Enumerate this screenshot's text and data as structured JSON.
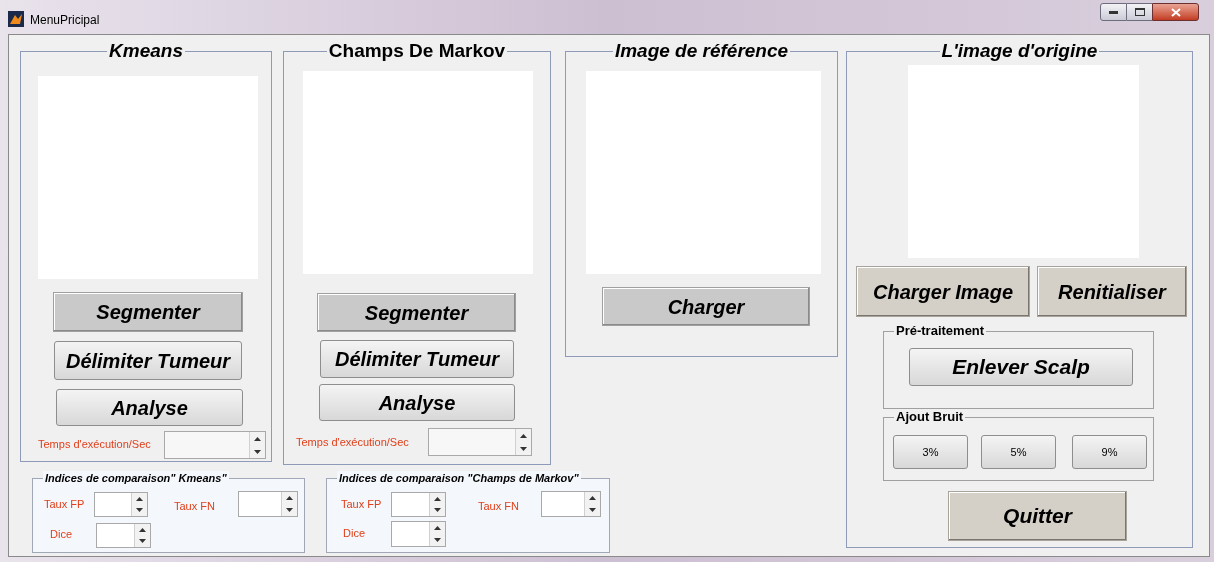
{
  "window": {
    "title": "MenuPricipal"
  },
  "panels": [
    {
      "title": "Kmeans",
      "buttons": [
        {
          "label": "Segmenter",
          "kind": "flat"
        },
        {
          "label": "Délimiter Tumeur",
          "kind": "raised"
        },
        {
          "label": "Analyse",
          "kind": "raised"
        }
      ],
      "time_label": "Temps d'exécution/Sec"
    },
    {
      "title": "Champs De Markov",
      "buttons": [
        {
          "label": "Segmenter",
          "kind": "flat"
        },
        {
          "label": "Délimiter Tumeur",
          "kind": "raised"
        },
        {
          "label": "Analyse",
          "kind": "raised"
        }
      ],
      "time_label": "Temps d'exécution/Sec"
    },
    {
      "title": "Image de référence",
      "buttons": [
        {
          "label": "Charger",
          "kind": "flat"
        }
      ]
    }
  ],
  "origin_panel": {
    "title": "L'image d'origine",
    "buttons": [
      {
        "label": "Charger Image",
        "kind": "beige"
      },
      {
        "label": "Renitialiser",
        "kind": "beige"
      }
    ],
    "preprocessing": {
      "title": "Pré-traitement",
      "button": "Enlever Scalp"
    },
    "noise": {
      "title": "Ajout Bruit",
      "buttons": [
        "3%",
        "5%",
        "9%"
      ]
    },
    "quit_button": "Quitter"
  },
  "comparison_panels": [
    {
      "title": "Indices de comparaison\" Kmeans\"",
      "fields": [
        "Taux FP",
        "Taux FN",
        "Dice"
      ]
    },
    {
      "title": "Indices de comparaison \"Champs de Markov\"",
      "fields": [
        "Taux FP",
        "Taux FN",
        "Dice"
      ]
    }
  ]
}
